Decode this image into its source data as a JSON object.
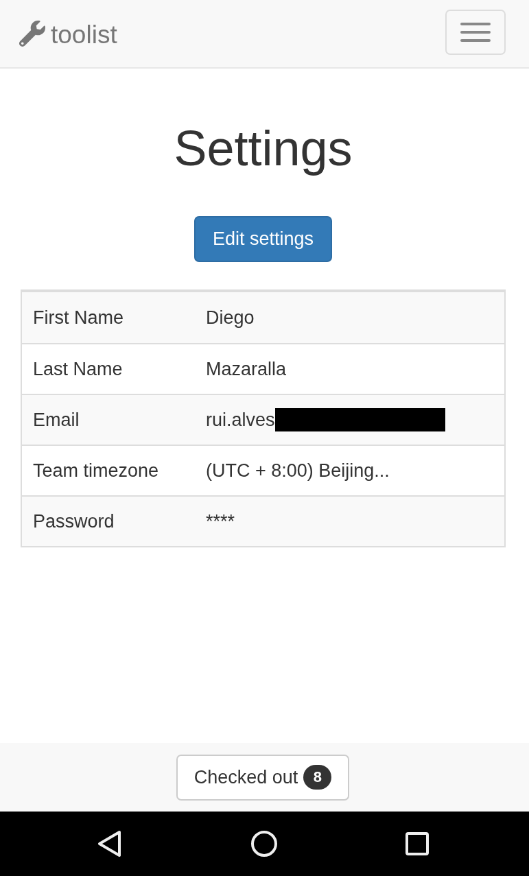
{
  "navbar": {
    "brand": "toolist"
  },
  "page": {
    "title": "Settings",
    "edit_button": "Edit settings"
  },
  "table": {
    "rows": [
      {
        "label": "First Name",
        "value": "Diego",
        "redacted": false
      },
      {
        "label": "Last Name",
        "value": "Mazaralla",
        "redacted": false
      },
      {
        "label": "Email",
        "value": "rui.alves",
        "redacted": true
      },
      {
        "label": "Team timezone",
        "value": "(UTC + 8:00) Beijing...",
        "redacted": false
      },
      {
        "label": "Password",
        "value": "****",
        "redacted": false
      }
    ]
  },
  "footer": {
    "button": {
      "label": "Checked out",
      "badge": "8"
    }
  }
}
